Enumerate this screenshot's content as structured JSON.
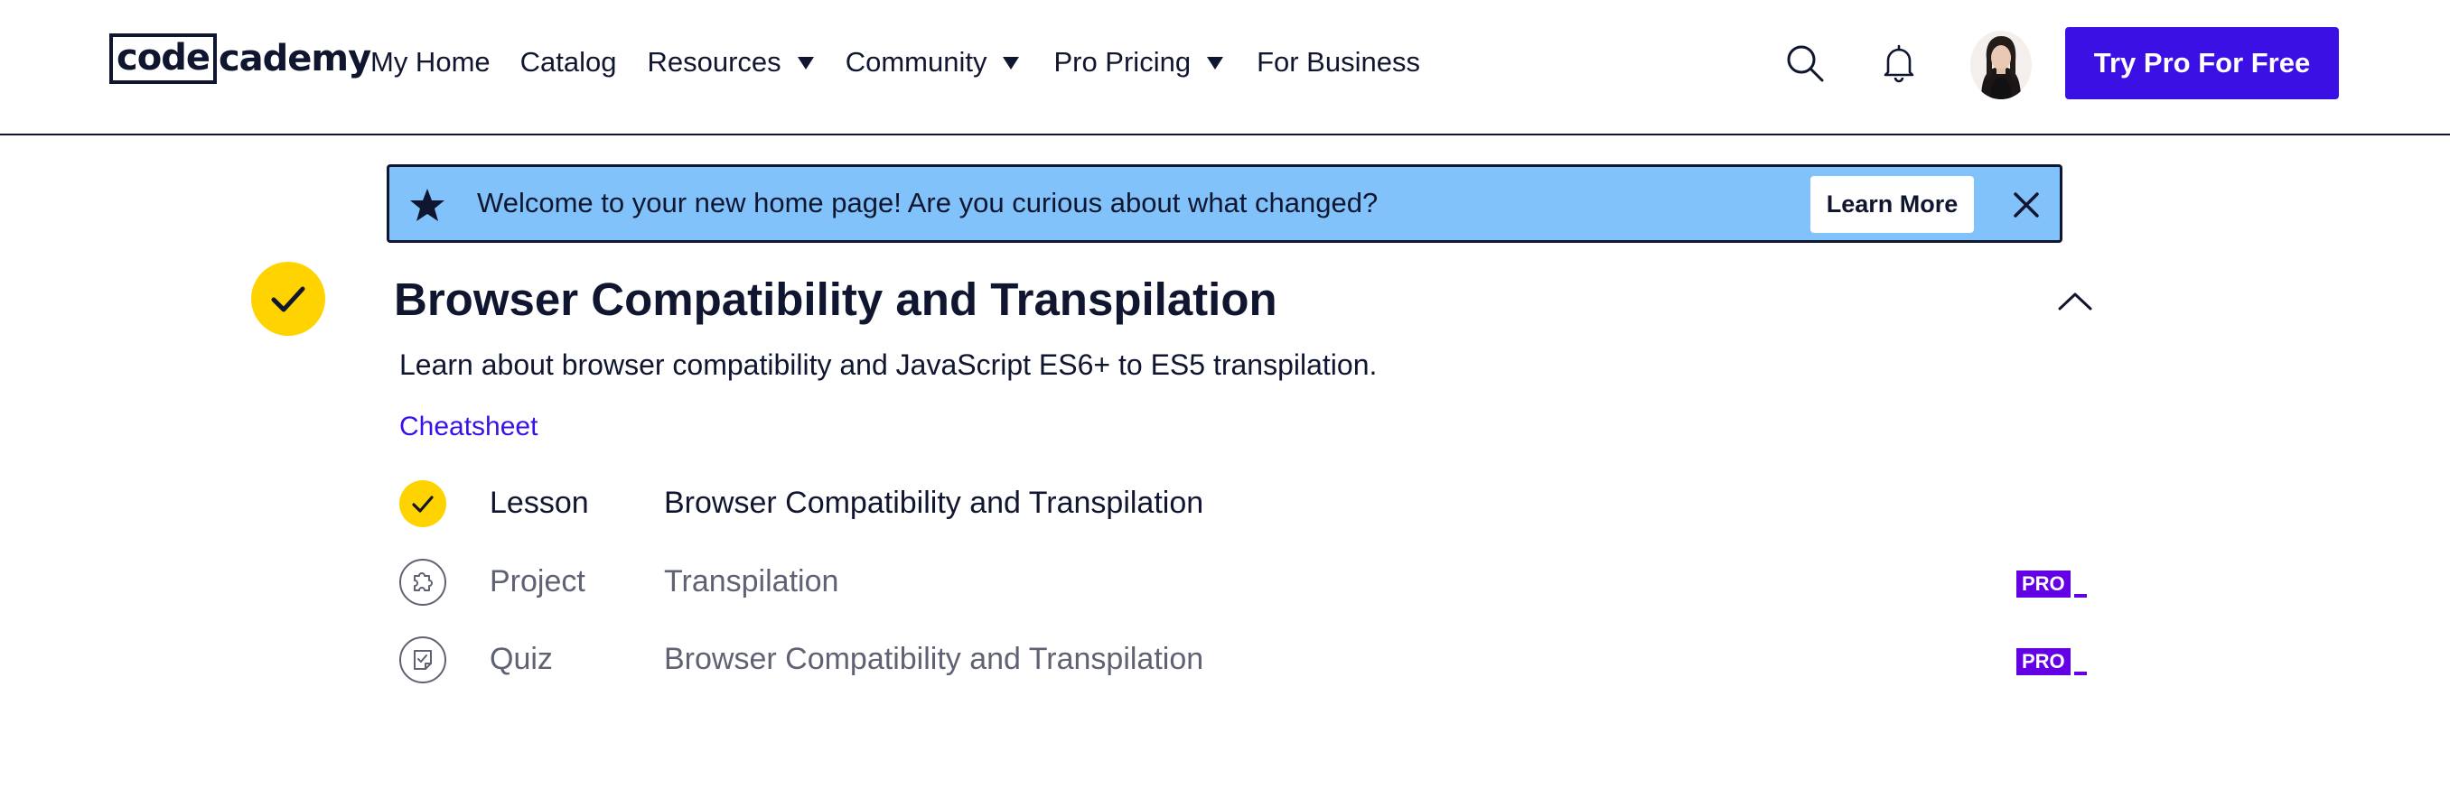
{
  "header": {
    "logo": {
      "part1": "code",
      "part2": "cademy"
    },
    "nav": [
      {
        "label": "My Home"
      },
      {
        "label": "Catalog"
      },
      {
        "label": "Resources"
      },
      {
        "label": "Community"
      },
      {
        "label": "Pro Pricing"
      },
      {
        "label": "For Business"
      }
    ],
    "icons": {
      "search": "search-icon",
      "notifications": "bell-icon",
      "avatar": "user-avatar"
    },
    "cta_label": "Try Pro For Free"
  },
  "banner": {
    "icon": "star-icon",
    "text": "Welcome to your new home page! Are you curious about what changed?",
    "button_label": "Learn More",
    "close_icon": "close-icon"
  },
  "module": {
    "status": "completed",
    "title": "Browser Compatibility and Transpilation",
    "description": "Learn about browser compatibility and JavaScript ES6+ to ES5 transpilation.",
    "cheatsheet_label": "Cheatsheet",
    "items": [
      {
        "type": "Lesson",
        "name": "Browser Compatibility and Transpilation",
        "status": "completed",
        "icon": "check-icon",
        "pro": false
      },
      {
        "type": "Project",
        "name": "Transpilation",
        "status": "locked",
        "icon": "puzzle-icon",
        "pro": true,
        "badge": "PRO"
      },
      {
        "type": "Quiz",
        "name": "Browser Compatibility and Transpilation",
        "status": "locked",
        "icon": "quiz-icon",
        "pro": true,
        "badge": "PRO"
      }
    ]
  },
  "colors": {
    "brand_text": "#10162f",
    "cta": "#3a10e5",
    "banner": "#80c2f9",
    "check": "#ffd300",
    "pro": "#6400e4",
    "link": "#3a10e5",
    "muted": "#5f6273"
  }
}
